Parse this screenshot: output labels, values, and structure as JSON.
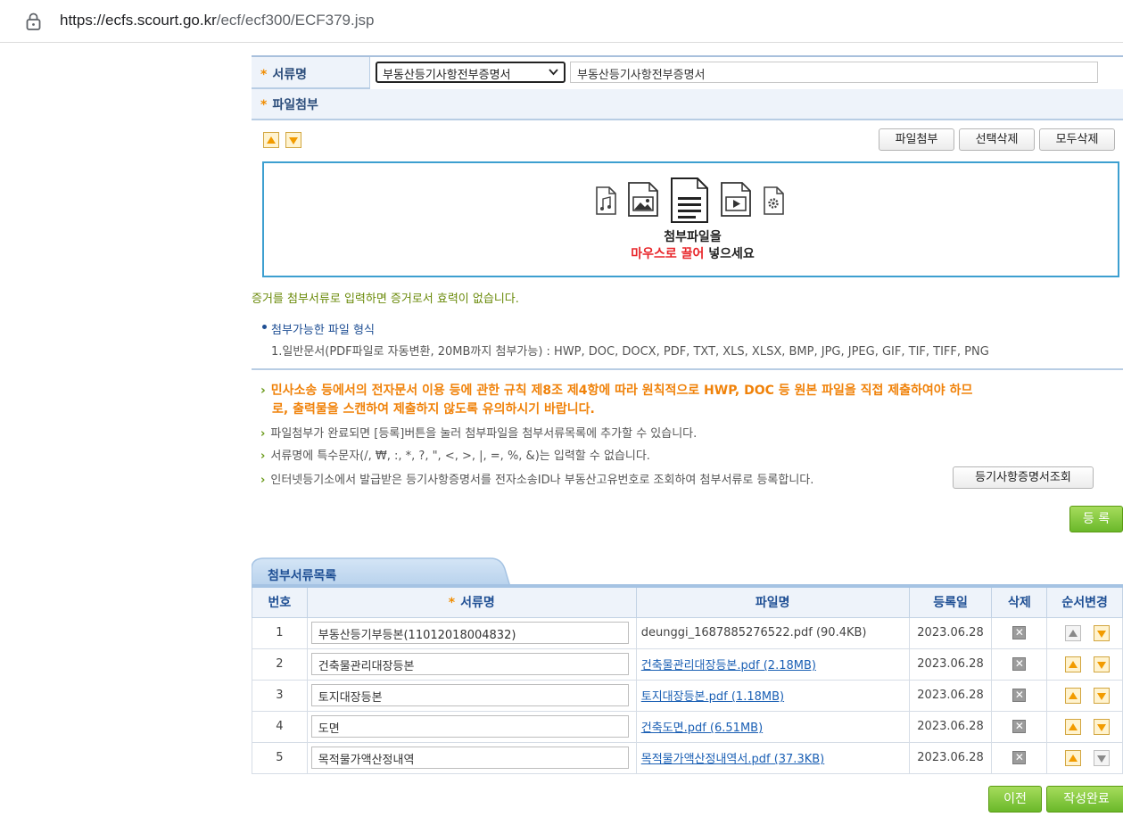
{
  "browser": {
    "url_host": "https://ecfs.scourt.go.kr",
    "url_path": "/ecf/ecf300/ECF379.jsp"
  },
  "form": {
    "doc_name_label": "서류명",
    "doc_select_value": "부동산등기사항전부증명서",
    "doc_text_value": "부동산등기사항전부증명서",
    "file_attach_label": "파일첨부"
  },
  "toolbar": {
    "attach_button": "파일첨부",
    "delete_selected_button": "선택삭제",
    "delete_all_button": "모두삭제"
  },
  "dropzone": {
    "line1": "첨부파일을",
    "line2_red": "마우스로 끌어",
    "line2_rest": " 넣으세요"
  },
  "messages": {
    "evidence_warning": "증거를 첨부서류로 입력하면 증거로서 효력이 없습니다.",
    "formats_title": "첨부가능한 파일 형식",
    "formats_list": "1.일반문서(PDF파일로 자동변환, 20MB까지 첨부가능) : HWP, DOC, DOCX, PDF, TXT, XLS, XLSX, BMP, JPG, JPEG, GIF, TIF, TIFF, PNG",
    "orange_line1": "민사소송 등에서의 전자문서 이용 등에 관한 규칙 제8조 제4항에 따라 원칙적으로 HWP, DOC 등 원본 파일을 직접 제출하여야 하므",
    "orange_line2": "로, 출력물을 스캔하여 제출하지 않도록 유의하시기 바랍니다.",
    "note1": "파일첨부가 완료되면 [등록]버튼을 눌러 첨부파일을 첨부서류목록에 추가할 수 있습니다.",
    "note2": "서류명에 특수문자(/, ₩, :, *, ?, \", <, >, |, =, %, &)는 입력할 수 없습니다.",
    "note3": "인터넷등기소에서 발급받은 등기사항증명서를 전자소송ID나 부동산고유번호로 조회하여 첨부서류로 등록합니다.",
    "registry_lookup_button": "등기사항증명서조회"
  },
  "register_button": "등 록",
  "list": {
    "tab_label": "첨부서류목록",
    "headers": {
      "no": "번호",
      "doc_name": "서류명",
      "file_name": "파일명",
      "date": "등록일",
      "delete": "삭제",
      "order": "순서변경"
    },
    "rows": [
      {
        "no": "1",
        "doc_name": "부동산등기부등본(11012018004832)",
        "file_name": "deunggi_1687885276522.pdf (90.4KB)",
        "file_link": false,
        "date": "2023.06.28"
      },
      {
        "no": "2",
        "doc_name": "건축물관리대장등본",
        "file_name": "건축물관리대장등본.pdf (2.18MB)",
        "file_link": true,
        "date": "2023.06.28"
      },
      {
        "no": "3",
        "doc_name": "토지대장등본",
        "file_name": "토지대장등본.pdf (1.18MB)",
        "file_link": true,
        "date": "2023.06.28"
      },
      {
        "no": "4",
        "doc_name": "도면",
        "file_name": "건축도면.pdf (6.51MB)",
        "file_link": true,
        "date": "2023.06.28"
      },
      {
        "no": "5",
        "doc_name": "목적물가액산정내역",
        "file_name": "목적물가액산정내역서.pdf (37.3KB)",
        "file_link": true,
        "date": "2023.06.28"
      }
    ]
  },
  "footer": {
    "prev_button": "이전",
    "complete_button": "작성완료"
  },
  "colors": {
    "accent_blue": "#1f4f94",
    "orange": "#f0820a",
    "green_button": "#6ab82a",
    "dropzone_border": "#3d9fd0"
  }
}
